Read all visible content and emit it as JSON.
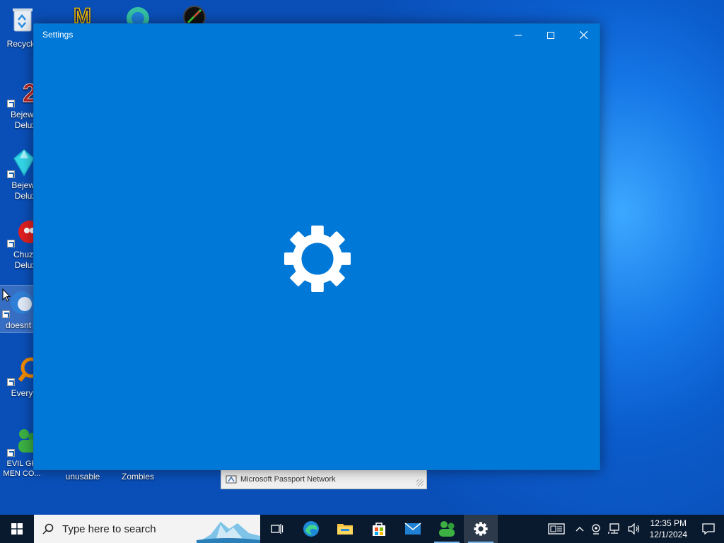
{
  "desktop": {
    "icons": [
      {
        "label": "Recycle"
      },
      {
        "label": "Bejewel Delux"
      },
      {
        "label": "Bejewe Delux"
      },
      {
        "label": "Chuzz Delux"
      },
      {
        "label": "doesnt"
      },
      {
        "label": "Everyth"
      },
      {
        "label": "EVIL GR MEN CO..."
      },
      {
        "label": "unusable"
      },
      {
        "label": "Zombies"
      }
    ]
  },
  "window": {
    "title": "Settings",
    "splash_icon": "gear-icon",
    "accent": "#0078d7"
  },
  "passport": {
    "label": "Microsoft Passport Network"
  },
  "taskbar": {
    "search_placeholder": "Type here to search",
    "pinned": [
      "task-view-icon",
      "edge-icon",
      "file-explorer-icon",
      "store-icon",
      "mail-icon",
      "evil-green-men-icon",
      "settings-icon"
    ],
    "clock_time": "12:35 PM",
    "clock_date": "12/1/2024"
  }
}
